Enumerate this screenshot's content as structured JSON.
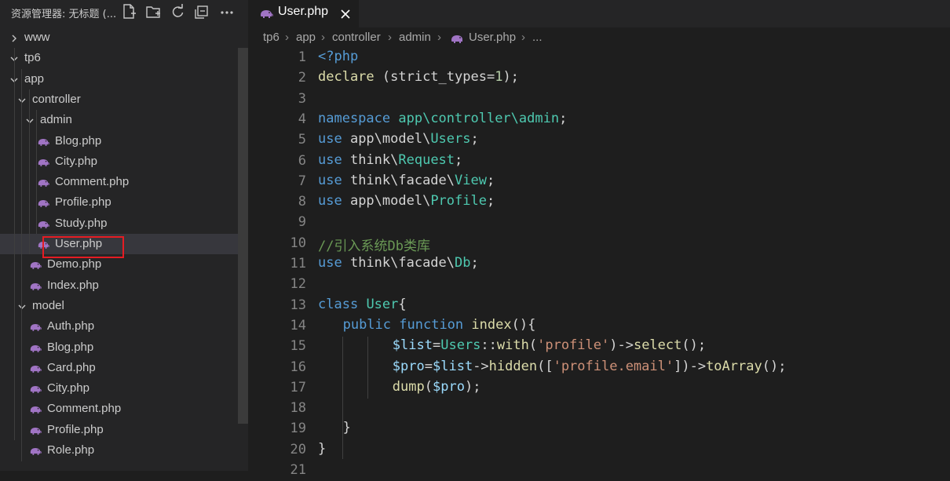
{
  "sidebar": {
    "title": "资源管理器: 无标题 (...",
    "header_icons": [
      "new-file-icon",
      "new-folder-icon",
      "refresh-icon",
      "collapse-all-icon",
      "more-icon"
    ],
    "tree": [
      {
        "label": "www",
        "type": "folder",
        "expanded": false,
        "depth": 0
      },
      {
        "label": "tp6",
        "type": "folder",
        "expanded": true,
        "depth": 0
      },
      {
        "label": "app",
        "type": "folder",
        "expanded": true,
        "depth": 1
      },
      {
        "label": "controller",
        "type": "folder",
        "expanded": true,
        "depth": 2
      },
      {
        "label": "admin",
        "type": "folder",
        "expanded": true,
        "depth": 3
      },
      {
        "label": "Blog.php",
        "type": "php",
        "depth": 4
      },
      {
        "label": "City.php",
        "type": "php",
        "depth": 4
      },
      {
        "label": "Comment.php",
        "type": "php",
        "depth": 4
      },
      {
        "label": "Profile.php",
        "type": "php",
        "depth": 4
      },
      {
        "label": "Study.php",
        "type": "php",
        "depth": 4
      },
      {
        "label": "User.php",
        "type": "php",
        "depth": 4,
        "selected": true
      },
      {
        "label": "Demo.php",
        "type": "php",
        "depth": 3
      },
      {
        "label": "Index.php",
        "type": "php",
        "depth": 3
      },
      {
        "label": "model",
        "type": "folder",
        "expanded": true,
        "depth": 2
      },
      {
        "label": "Auth.php",
        "type": "php",
        "depth": 3
      },
      {
        "label": "Blog.php",
        "type": "php",
        "depth": 3
      },
      {
        "label": "Card.php",
        "type": "php",
        "depth": 3
      },
      {
        "label": "City.php",
        "type": "php",
        "depth": 3
      },
      {
        "label": "Comment.php",
        "type": "php",
        "depth": 3
      },
      {
        "label": "Profile.php",
        "type": "php",
        "depth": 3
      },
      {
        "label": "Role.php",
        "type": "php",
        "depth": 3
      }
    ]
  },
  "tab": {
    "label": "User.php",
    "icon": "php-elephant-icon"
  },
  "breadcrumb": [
    "tp6",
    "app",
    "controller",
    "admin",
    "User.php",
    "..."
  ],
  "editor": {
    "lines": [
      {
        "n": "1",
        "indent": 0,
        "tokens": [
          [
            "kw",
            "<?php"
          ]
        ]
      },
      {
        "n": "2",
        "indent": 0,
        "tokens": [
          [
            "fn",
            "declare"
          ],
          [
            "pl",
            " (strict_types="
          ],
          [
            "num",
            "1"
          ],
          [
            "pl",
            ");"
          ]
        ]
      },
      {
        "n": "3",
        "indent": 0,
        "tokens": []
      },
      {
        "n": "4",
        "indent": 0,
        "tokens": [
          [
            "kw",
            "namespace"
          ],
          [
            "pl",
            " "
          ],
          [
            "cls",
            "app\\controller\\admin"
          ],
          [
            "pl",
            ";"
          ]
        ]
      },
      {
        "n": "5",
        "indent": 0,
        "tokens": [
          [
            "kw",
            "use"
          ],
          [
            "pl",
            " app\\model\\"
          ],
          [
            "cls",
            "Users"
          ],
          [
            "pl",
            ";"
          ]
        ]
      },
      {
        "n": "6",
        "indent": 0,
        "tokens": [
          [
            "kw",
            "use"
          ],
          [
            "pl",
            " think\\"
          ],
          [
            "cls",
            "Request"
          ],
          [
            "pl",
            ";"
          ]
        ]
      },
      {
        "n": "7",
        "indent": 0,
        "tokens": [
          [
            "kw",
            "use"
          ],
          [
            "pl",
            " think\\facade\\"
          ],
          [
            "cls",
            "View"
          ],
          [
            "pl",
            ";"
          ]
        ]
      },
      {
        "n": "8",
        "indent": 0,
        "tokens": [
          [
            "kw",
            "use"
          ],
          [
            "pl",
            " app\\model\\"
          ],
          [
            "cls",
            "Profile"
          ],
          [
            "pl",
            ";"
          ]
        ]
      },
      {
        "n": "9",
        "indent": 0,
        "tokens": []
      },
      {
        "n": "10",
        "indent": 0,
        "tokens": [
          [
            "cm",
            "//引入系统Db类库"
          ]
        ]
      },
      {
        "n": "11",
        "indent": 0,
        "tokens": [
          [
            "kw",
            "use"
          ],
          [
            "pl",
            " think\\facade\\"
          ],
          [
            "cls",
            "Db"
          ],
          [
            "pl",
            ";"
          ]
        ]
      },
      {
        "n": "12",
        "indent": 0,
        "tokens": []
      },
      {
        "n": "13",
        "indent": 0,
        "tokens": [
          [
            "kw",
            "class"
          ],
          [
            "pl",
            " "
          ],
          [
            "cls",
            "User"
          ],
          [
            "pl",
            "{"
          ]
        ]
      },
      {
        "n": "14",
        "indent": 1,
        "tokens": [
          [
            "kw",
            "public"
          ],
          [
            "pl",
            " "
          ],
          [
            "kw",
            "function"
          ],
          [
            "pl",
            " "
          ],
          [
            "fn",
            "index"
          ],
          [
            "pl",
            "(){"
          ]
        ]
      },
      {
        "n": "15",
        "indent": 3,
        "tokens": [
          [
            "var",
            "$list"
          ],
          [
            "pl",
            "="
          ],
          [
            "cls",
            "Users"
          ],
          [
            "pl",
            "::"
          ],
          [
            "fn",
            "with"
          ],
          [
            "pl",
            "("
          ],
          [
            "str",
            "'profile'"
          ],
          [
            "pl",
            ")->"
          ],
          [
            "fn",
            "select"
          ],
          [
            "pl",
            "();"
          ]
        ]
      },
      {
        "n": "16",
        "indent": 3,
        "tokens": [
          [
            "var",
            "$pro"
          ],
          [
            "pl",
            "="
          ],
          [
            "var",
            "$list"
          ],
          [
            "pl",
            "->"
          ],
          [
            "fn",
            "hidden"
          ],
          [
            "pl",
            "(["
          ],
          [
            "str",
            "'profile.email'"
          ],
          [
            "pl",
            "])->"
          ],
          [
            "fn",
            "toArray"
          ],
          [
            "pl",
            "();"
          ]
        ]
      },
      {
        "n": "17",
        "indent": 3,
        "tokens": [
          [
            "fn",
            "dump"
          ],
          [
            "pl",
            "("
          ],
          [
            "var",
            "$pro"
          ],
          [
            "pl",
            ");"
          ]
        ]
      },
      {
        "n": "18",
        "indent": 0,
        "tokens": []
      },
      {
        "n": "19",
        "indent": 1,
        "tokens": [
          [
            "pl",
            "}"
          ]
        ]
      },
      {
        "n": "20",
        "indent": 0,
        "tokens": [
          [
            "pl",
            "}"
          ]
        ]
      },
      {
        "n": "21",
        "indent": 0,
        "tokens": []
      }
    ]
  },
  "colors": {
    "keyword": "#569cd6",
    "function": "#dcdcaa",
    "class": "#4ec9b0",
    "string": "#ce9178",
    "number": "#b5cea8",
    "variable": "#9cdcfe",
    "comment": "#6a9955",
    "php_icon": "#a074c4",
    "highlight_box": "#e51c23"
  }
}
